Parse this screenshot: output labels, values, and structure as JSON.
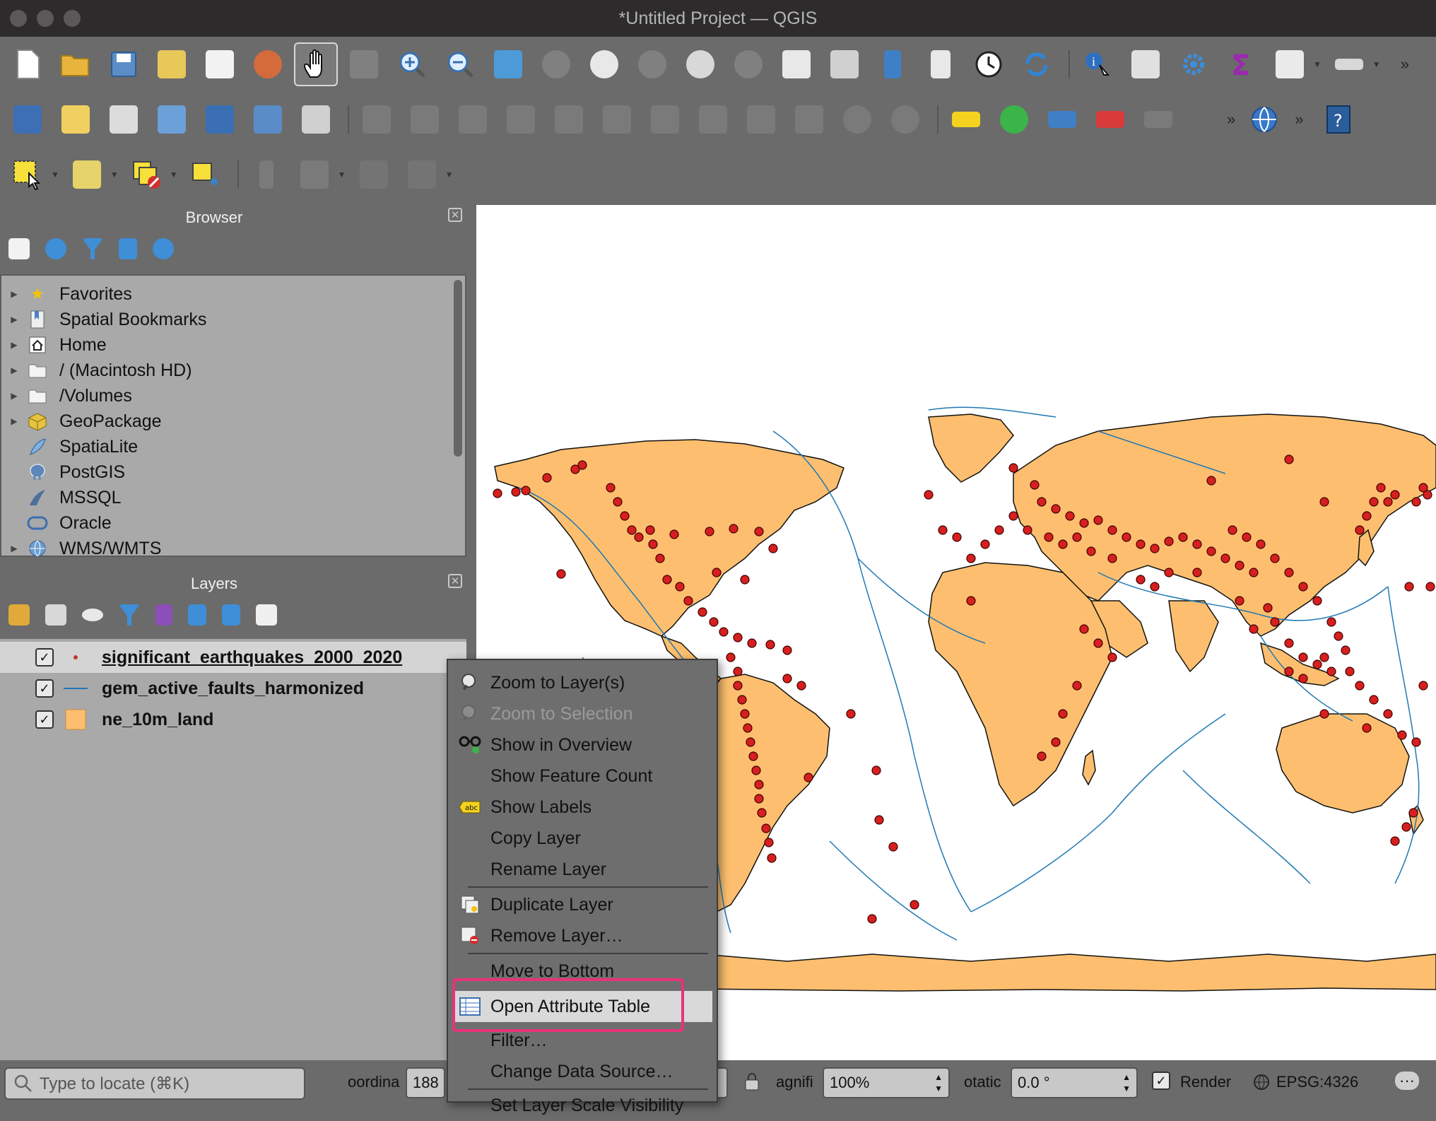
{
  "window": {
    "title": "*Untitled Project — QGIS"
  },
  "browser": {
    "title": "Browser",
    "items": [
      {
        "label": "Favorites"
      },
      {
        "label": "Spatial Bookmarks"
      },
      {
        "label": "Home"
      },
      {
        "label": "/ (Macintosh HD)"
      },
      {
        "label": "/Volumes"
      },
      {
        "label": "GeoPackage"
      },
      {
        "label": "SpatiaLite"
      },
      {
        "label": "PostGIS"
      },
      {
        "label": "MSSQL"
      },
      {
        "label": "Oracle"
      },
      {
        "label": "WMS/WMTS"
      }
    ]
  },
  "layers": {
    "title": "Layers",
    "items": [
      {
        "label": "significant_earthquakes_2000_2020",
        "checked": true
      },
      {
        "label": "gem_active_faults_harmonized",
        "checked": true
      },
      {
        "label": "ne_10m_land",
        "checked": true
      }
    ]
  },
  "context_menu": {
    "items": [
      {
        "label": "Zoom to Layer(s)",
        "icon": "zoom-layer-icon"
      },
      {
        "label": "Zoom to Selection",
        "icon": "zoom-selection-icon",
        "disabled": true
      },
      {
        "label": "Show in Overview",
        "icon": "overview-glasses-icon"
      },
      {
        "label": "Show Feature Count"
      },
      {
        "label": "Show Labels",
        "icon": "labels-abc-icon"
      },
      {
        "label": "Copy Layer"
      },
      {
        "label": "Rename Layer"
      },
      {
        "label": "Duplicate Layer",
        "icon": "duplicate-layer-icon"
      },
      {
        "label": "Remove Layer…",
        "icon": "remove-layer-icon"
      },
      {
        "label": "Move to Bottom"
      },
      {
        "label": "Open Attribute Table",
        "icon": "attribute-table-icon",
        "highlighted": true
      },
      {
        "label": "Filter…"
      },
      {
        "label": "Change Data Source…"
      },
      {
        "label": "Set Layer Scale Visibility"
      }
    ]
  },
  "statusbar": {
    "locator_placeholder": "Type to locate (⌘K)",
    "coordinate_label": "oordina",
    "coordinate_value": "188",
    "magnifier_label": "agnifi",
    "magnifier_value": "100%",
    "rotation_label": "otatic",
    "rotation_value": "0.0 °",
    "render_label": "Render",
    "crs_label": "EPSG:4326",
    "more_label": "···"
  },
  "colors": {
    "land": "#fdbf6f",
    "faults": "#1f78b4",
    "quakes": "#e31a1c",
    "highlight": "#e8337a"
  }
}
